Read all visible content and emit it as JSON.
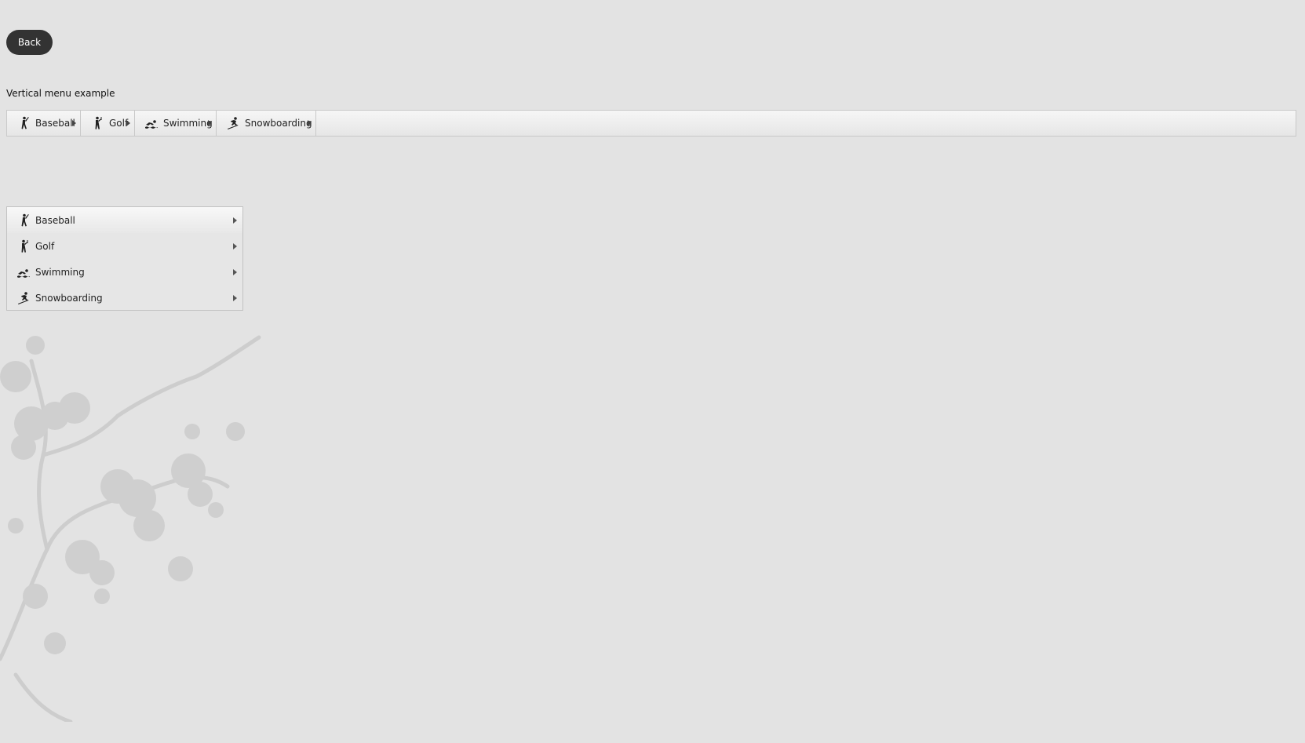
{
  "back_button": {
    "label": "Back"
  },
  "section_title": "Vertical menu example",
  "horizontal_menu": {
    "items": [
      {
        "label": "Baseball",
        "icon": "baseball-icon"
      },
      {
        "label": "Golf",
        "icon": "golf-icon"
      },
      {
        "label": "Swimming",
        "icon": "swimming-icon"
      },
      {
        "label": "Snowboarding",
        "icon": "snowboarding-icon"
      }
    ]
  },
  "vertical_menu": {
    "items": [
      {
        "label": "Baseball",
        "icon": "baseball-icon"
      },
      {
        "label": "Golf",
        "icon": "golf-icon"
      },
      {
        "label": "Swimming",
        "icon": "swimming-icon"
      },
      {
        "label": "Snowboarding",
        "icon": "snowboarding-icon"
      }
    ]
  },
  "colors": {
    "background": "#e3e3e3",
    "button_bg": "#333333",
    "button_text": "#ffffff",
    "menu_border": "#c9c9c9",
    "decoration": "#cfcfcf"
  }
}
